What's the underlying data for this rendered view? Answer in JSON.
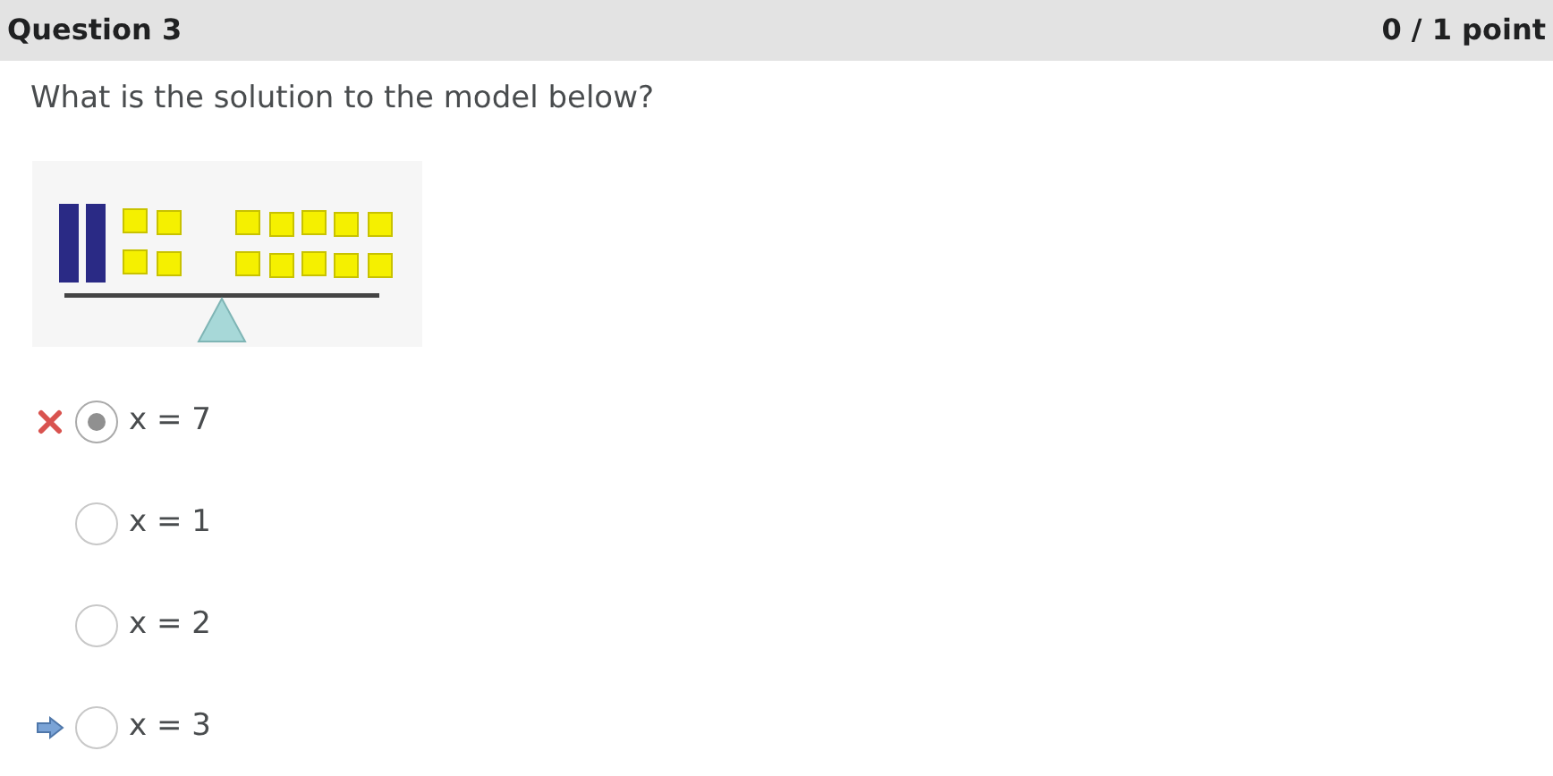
{
  "header": {
    "title": "Question 3",
    "score": "0 / 1 point"
  },
  "question": "What is the solution to the model below?",
  "options": [
    {
      "label": "x = 7",
      "selected": true,
      "marked_incorrect": true,
      "marked_correct": false
    },
    {
      "label": "x = 1",
      "selected": false,
      "marked_incorrect": false,
      "marked_correct": false
    },
    {
      "label": "x = 2",
      "selected": false,
      "marked_incorrect": false,
      "marked_correct": false
    },
    {
      "label": "x = 3",
      "selected": false,
      "marked_incorrect": false,
      "marked_correct": true
    }
  ]
}
